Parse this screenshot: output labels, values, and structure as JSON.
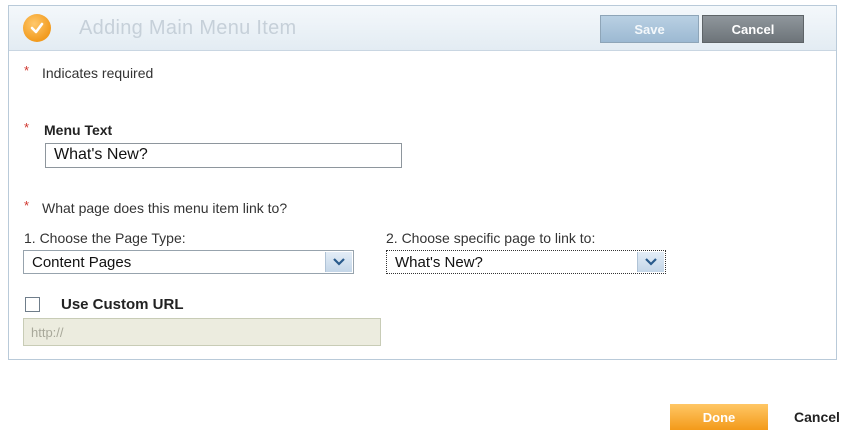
{
  "header": {
    "title": "Adding Main Menu Item",
    "save_label": "Save",
    "cancel_label": "Cancel",
    "logo_icon": "check-circle-icon"
  },
  "form": {
    "required_note": "Indicates required",
    "required_mark": "*",
    "menu_text_label": "Menu Text",
    "menu_text_value": "What's New?",
    "link_question": "What page does this menu item link to?",
    "page_type_label": "1. Choose the Page Type:",
    "page_type_value": "Content Pages",
    "specific_page_label": "2. Choose specific page to link to:",
    "specific_page_value": "What's New?",
    "custom_url_label": "Use Custom URL",
    "custom_url_checked": false,
    "custom_url_placeholder": "http://"
  },
  "footer": {
    "done_label": "Done",
    "cancel_label": "Cancel"
  },
  "colors": {
    "accent_orange": "#f39a1a",
    "required_red": "#d0342c",
    "header_bg": "#e3ecf3"
  }
}
